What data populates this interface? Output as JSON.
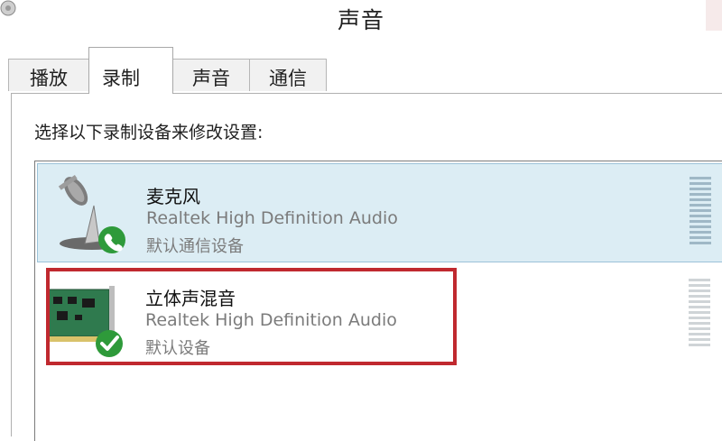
{
  "window": {
    "title": "声音"
  },
  "tabs": [
    {
      "label": "播放",
      "active": false
    },
    {
      "label": "录制",
      "active": true
    },
    {
      "label": "声音",
      "active": false
    },
    {
      "label": "通信",
      "active": false
    }
  ],
  "recording": {
    "instruction": "选择以下录制设备来修改设置:",
    "devices": [
      {
        "name": "麦克风",
        "driver": "Realtek High Definition Audio",
        "status": "默认通信设备",
        "icon": "microphone-icon",
        "badge_icon": "phone-badge-icon",
        "selected": true
      },
      {
        "name": "立体声混音",
        "driver": "Realtek High Definition Audio",
        "status": "默认设备",
        "icon": "sound-card-icon",
        "badge_icon": "check-badge-icon",
        "selected": false
      }
    ]
  },
  "colors": {
    "selection": "#dcedf4",
    "highlight_border": "#c0292f",
    "badge_green": "#2e9a3a"
  }
}
